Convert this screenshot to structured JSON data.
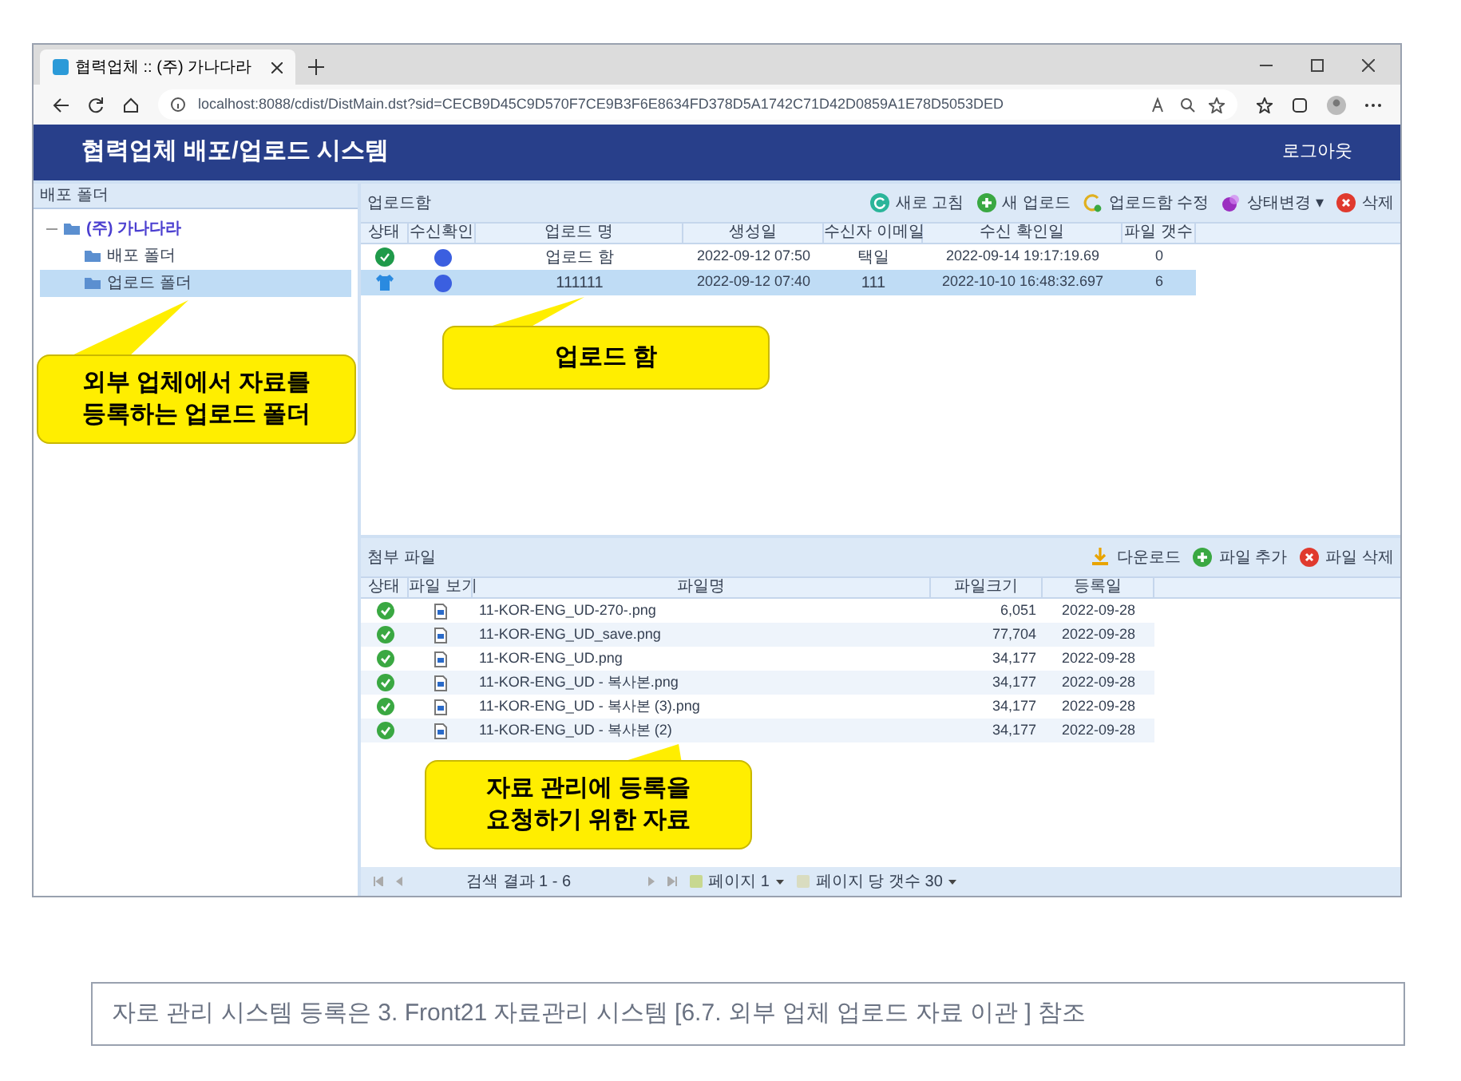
{
  "browser": {
    "tab_title": "협력업체 :: (주) 가나다라",
    "url": "localhost:8088/cdist/DistMain.dst?sid=CECB9D45C9D570F7CE9B3F6E8634FD378D5A1742C71D42D0859A1E78D5053DED"
  },
  "header": {
    "title": "협력업체 배포/업로드 시스템",
    "logout": "로그아웃"
  },
  "sidebar": {
    "title": "배포 폴더",
    "tree": [
      {
        "label": "(주) 가나다라",
        "expanded": true,
        "selected": false,
        "children": [
          {
            "label": "배포 폴더",
            "selected": false
          },
          {
            "label": "업로드 폴더",
            "selected": true
          }
        ]
      }
    ]
  },
  "uploads": {
    "title": "업로드함",
    "toolbar": [
      {
        "kind": "refresh",
        "label": "새로 고침"
      },
      {
        "kind": "add",
        "label": "새 업로드"
      },
      {
        "kind": "edit",
        "label": "업로드함 수정"
      },
      {
        "kind": "status",
        "label": "상태변경",
        "caret": "▾"
      },
      {
        "kind": "delete",
        "label": "삭제"
      }
    ],
    "columns": [
      "상태",
      "수신확인",
      "업로드 명",
      "생성일",
      "수신자 이메일",
      "수신 확인일",
      "파일 갯수"
    ],
    "rows": [
      {
        "kind": "ok",
        "received": true,
        "name": "업로드 함",
        "created": "2022-09-12 07:50",
        "email": "택일",
        "confirmed": "2022-09-14 19:17:19.69",
        "file_count": "0",
        "selected": false
      },
      {
        "kind": "pending",
        "received": true,
        "name": "111111",
        "created": "2022-09-12 07:40",
        "email": "111",
        "confirmed": "2022-10-10 16:48:32.697",
        "file_count": "6",
        "selected": true
      }
    ]
  },
  "attachments": {
    "title": "첨부 파일",
    "toolbar": [
      {
        "kind": "download",
        "label": "다운로드"
      },
      {
        "kind": "add",
        "label": "파일 추가"
      },
      {
        "kind": "delete",
        "label": "파일 삭제"
      }
    ],
    "columns": [
      "상태",
      "파일 보기",
      "파일명",
      "파일크기",
      "등록일"
    ],
    "rows": [
      {
        "name": "11-KOR-ENG_UD-270-.png",
        "size": "6,051",
        "date": "2022-09-28"
      },
      {
        "name": "11-KOR-ENG_UD_save.png",
        "size": "77,704",
        "date": "2022-09-28"
      },
      {
        "name": "11-KOR-ENG_UD.png",
        "size": "34,177",
        "date": "2022-09-28"
      },
      {
        "name": "11-KOR-ENG_UD - 복사본.png",
        "size": "34,177",
        "date": "2022-09-28"
      },
      {
        "name": "11-KOR-ENG_UD - 복사본 (3).png",
        "size": "34,177",
        "date": "2022-09-28"
      },
      {
        "name": "11-KOR-ENG_UD - 복사본 (2)",
        "size": "34,177",
        "date": "2022-09-28"
      }
    ],
    "pager": {
      "results": "검색 결과 1 - 6",
      "page": "페이지 1",
      "per_page": "페이지 당 갯수 30"
    }
  },
  "callouts": [
    {
      "text": "외부 업체에서 자료를\n등록하는 업로드 폴더"
    },
    {
      "text": "업로드 함"
    },
    {
      "text": "자료 관리에 등록을\n요청하기 위한 자료"
    }
  ],
  "caption": "자로 관리 시스템 등록은 3. Front21 자료관리 시스템 [6.7. 외부 업체 업로드 자료 이관 ] 참조"
}
